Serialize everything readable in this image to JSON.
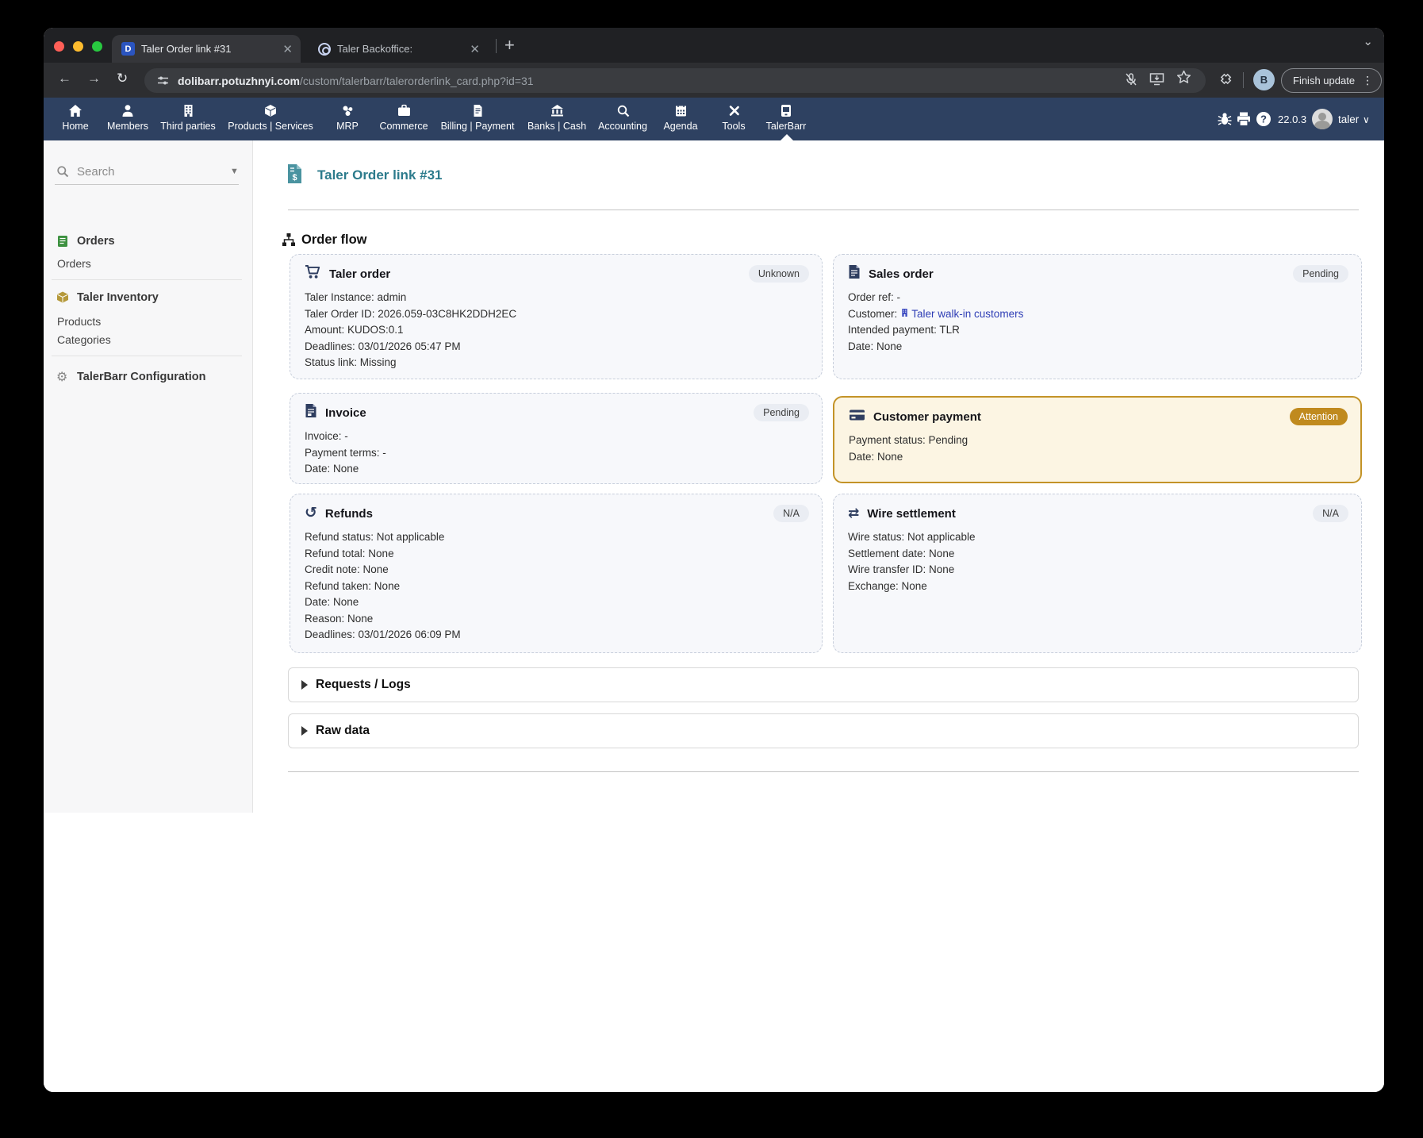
{
  "browser": {
    "tabs": [
      {
        "title": "Taler Order link #31",
        "favicon": "dolibarr-d",
        "active": true
      },
      {
        "title": "Taler Backoffice:",
        "favicon": "taler-rings",
        "active": false
      }
    ],
    "url_host": "dolibarr.potuzhnyi.com",
    "url_path": "/custom/talerbarr/talerorderlink_card.php?id=31",
    "profile_initial": "B",
    "update_button_label": "Finish update"
  },
  "topnav": {
    "items": [
      "Home",
      "Members",
      "Third parties",
      "Products | Services",
      "MRP",
      "Commerce",
      "Billing | Payment",
      "Banks | Cash",
      "Accounting",
      "Agenda",
      "Tools",
      "TalerBarr"
    ],
    "active_item": "TalerBarr",
    "version": "22.0.3",
    "user": "taler"
  },
  "sidebar": {
    "search_placeholder": "Search",
    "sections": [
      {
        "heading": "Orders",
        "icon": "green-document-icon",
        "items": [
          "Orders"
        ]
      },
      {
        "heading": "Taler Inventory",
        "icon": "gold-box-icon",
        "items": [
          "Products",
          "Categories"
        ]
      },
      {
        "heading": "TalerBarr Configuration",
        "icon": "gear-icon",
        "items": []
      }
    ]
  },
  "main": {
    "page_title": "Taler Order link #31",
    "section_title": "Order flow",
    "cards": [
      {
        "title": "Taler order",
        "icon": "cart-icon",
        "badge": "Unknown",
        "lines": [
          "Taler Instance: admin",
          "Taler Order ID: 2026.059-03C8HK2DDH2EC",
          "Amount: KUDOS:0.1",
          "Deadlines: 03/01/2026 05:47 PM",
          "Status link: Missing"
        ]
      },
      {
        "title": "Sales order",
        "icon": "document-icon",
        "badge": "Pending",
        "lines": [
          "Order ref: -",
          {
            "prefix": "Customer:",
            "link": "Taler walk-in customers"
          },
          "Intended payment: TLR",
          "Date: None"
        ]
      },
      {
        "title": "Invoice",
        "icon": "invoice-icon",
        "badge": "Pending",
        "lines": [
          "Invoice: -",
          "Payment terms: -",
          "Date: None"
        ]
      },
      {
        "title": "Customer payment",
        "icon": "credit-card-icon",
        "badge": "Attention",
        "lines": [
          "Payment status: Pending",
          "Date: None"
        ]
      },
      {
        "title": "Refunds",
        "icon": "undo-icon",
        "badge": "N/A",
        "lines": [
          "Refund status: Not applicable",
          "Refund total: None",
          "Credit note: None",
          "Refund taken: None",
          "Date: None",
          "Reason: None",
          "Deadlines: 03/01/2026 06:09 PM"
        ]
      },
      {
        "title": "Wire settlement",
        "icon": "transfer-icon",
        "badge": "N/A",
        "lines": [
          "Wire status: Not applicable",
          "Settlement date: None",
          "Wire transfer ID: None",
          "Exchange: None"
        ]
      }
    ],
    "collapsibles": [
      "Requests / Logs",
      "Raw data"
    ]
  },
  "colors": {
    "topnav_bg": "#2e4161",
    "accent_teal": "#2c7b8c",
    "attention_badge_bg": "#c08a1e",
    "attention_card_border": "#c39327",
    "attention_card_bg": "#fcf5e3",
    "link_blue": "#2f3eb5",
    "badge_bg": "#eaedf3"
  }
}
